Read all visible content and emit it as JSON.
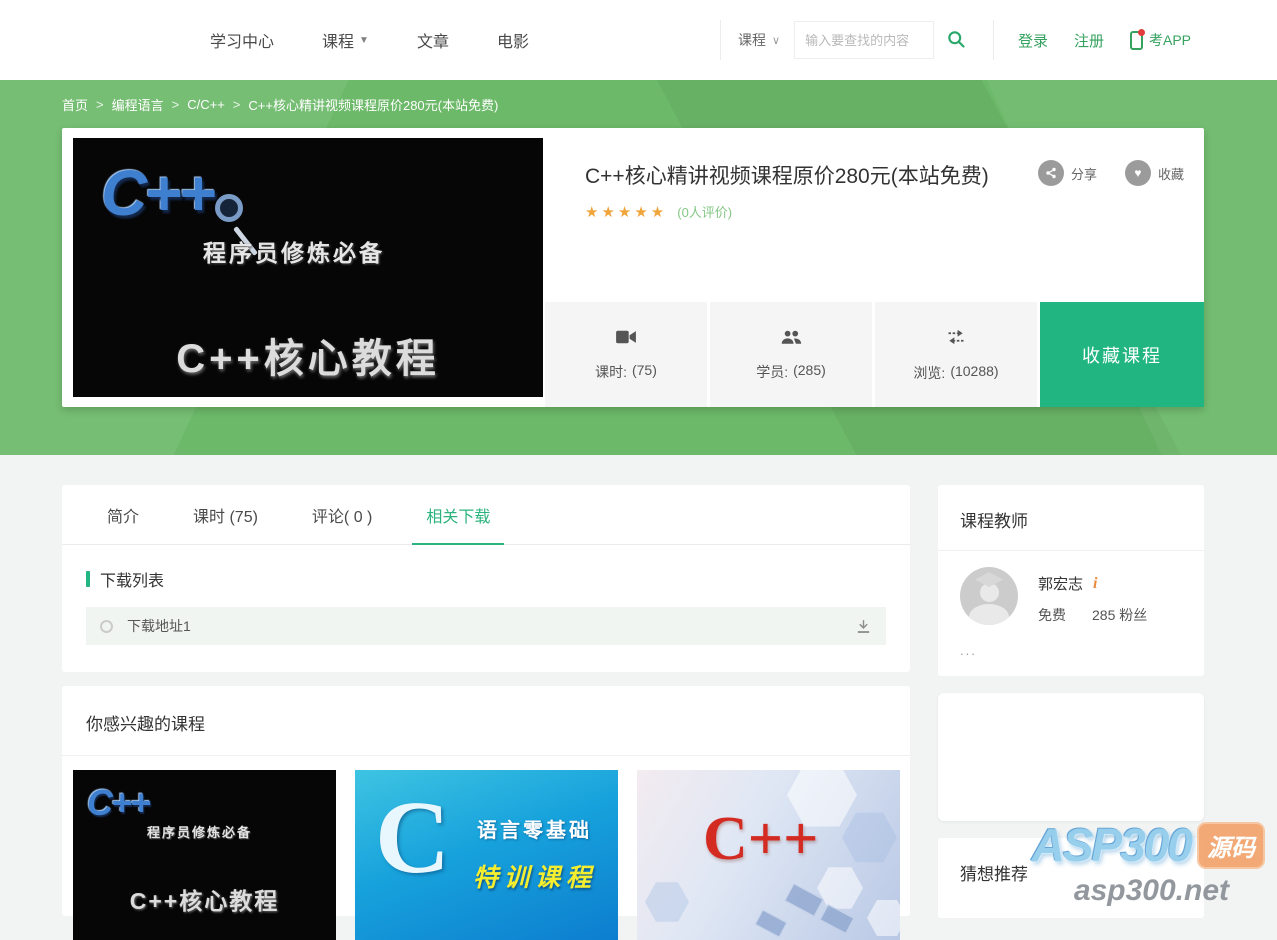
{
  "header": {
    "nav": [
      {
        "label": "学习中心"
      },
      {
        "label": "课程"
      },
      {
        "label": "文章"
      },
      {
        "label": "电影"
      }
    ],
    "search": {
      "category": "课程",
      "placeholder": "输入要查找的内容"
    },
    "auth": {
      "login": "登录",
      "register": "注册",
      "app": "考APP"
    }
  },
  "breadcrumb": {
    "separator": ">",
    "items": [
      {
        "label": "首页"
      },
      {
        "label": "编程语言"
      },
      {
        "label": "C/C++"
      },
      {
        "label": "C++核心精讲视频课程原价280元(本站免费)"
      }
    ]
  },
  "course": {
    "title": "C++核心精讲视频课程原价280元(本站免费)",
    "stars": "★★★★★",
    "rating_text": "(0人评价)",
    "share_label": "分享",
    "favorite_label": "收藏",
    "stats": [
      {
        "name": "课时:",
        "value": "(75)",
        "icon": "video-camera-icon"
      },
      {
        "name": "学员:",
        "value": "(285)",
        "icon": "students-icon"
      },
      {
        "name": "浏览:",
        "value": "(10288)",
        "icon": "views-exchange-icon"
      }
    ],
    "collect_button": "收藏课程",
    "cover": {
      "logo": "C++",
      "line1": "程序员修炼必备",
      "line2": "C++核心教程"
    }
  },
  "tabs": [
    {
      "label": "简介",
      "active": false
    },
    {
      "label": "课时 (75)",
      "active": false
    },
    {
      "label": "评论( 0 )",
      "active": false
    },
    {
      "label": "相关下载",
      "active": true
    }
  ],
  "downloads": {
    "section_title": "下载列表",
    "items": [
      {
        "label": "下载地址1"
      }
    ]
  },
  "related": {
    "title": "你感兴趣的课程",
    "courses": [
      {
        "cover_logo": "C++",
        "cover_line1": "程序员修炼必备",
        "cover_line2": "C++核心教程"
      },
      {
        "cover_big": "C",
        "cover_line1": "语言零基础",
        "cover_line2": "特训课程"
      },
      {
        "cover_big": "C++"
      }
    ]
  },
  "sidebar": {
    "teacher": {
      "card_title": "课程教师",
      "name": "郭宏志",
      "info_icon": "i",
      "price": "免费",
      "fans": "285 粉丝",
      "more": "..."
    },
    "recommend": {
      "card_title": "猜想推荐"
    }
  },
  "watermark": {
    "brand": "ASP300",
    "badge": "源码",
    "site": "asp300.net"
  },
  "colors": {
    "accent_green": "#35a25f",
    "button_green": "#21b582",
    "hero_green": "#6cb969",
    "tab_active_green": "#2db47e",
    "star_orange": "#efa53c"
  }
}
